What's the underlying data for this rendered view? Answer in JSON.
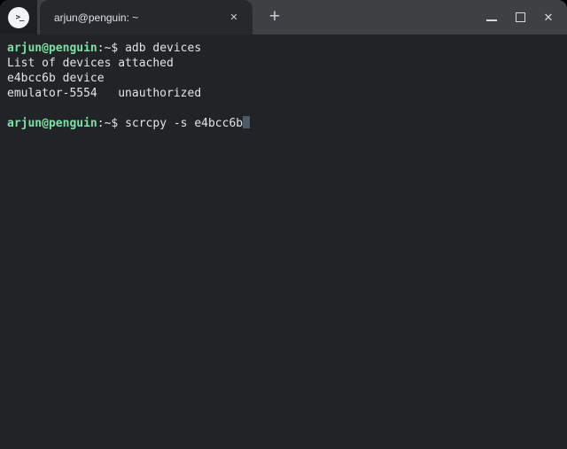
{
  "tab_bar": {
    "tab_title": "arjun@penguin: ~",
    "close_tab_icon": "✕",
    "new_tab_icon": "+",
    "app_icon_glyph": ">_"
  },
  "window_controls": {
    "close_icon": "✕"
  },
  "terminal": {
    "lines": [
      {
        "prompt": "arjun@penguin",
        "sep": ":~$ ",
        "command": "adb devices"
      },
      {
        "text": "List of devices attached"
      },
      {
        "text": "e4bcc6b device"
      },
      {
        "text": "emulator-5554   unauthorized"
      },
      {
        "text": ""
      },
      {
        "prompt": "arjun@penguin",
        "sep": ":~$ ",
        "command": "scrcpy -s e4bcc6b"
      }
    ]
  },
  "colors": {
    "prompt_green": "#7de0a6",
    "text": "#e2e4e8",
    "cursor": "#4e5a68",
    "strip_bg": "#3e4044",
    "tab_bg": "#26282c",
    "corner_bg": "#1d1f23",
    "terminal_bg": "#212327"
  }
}
